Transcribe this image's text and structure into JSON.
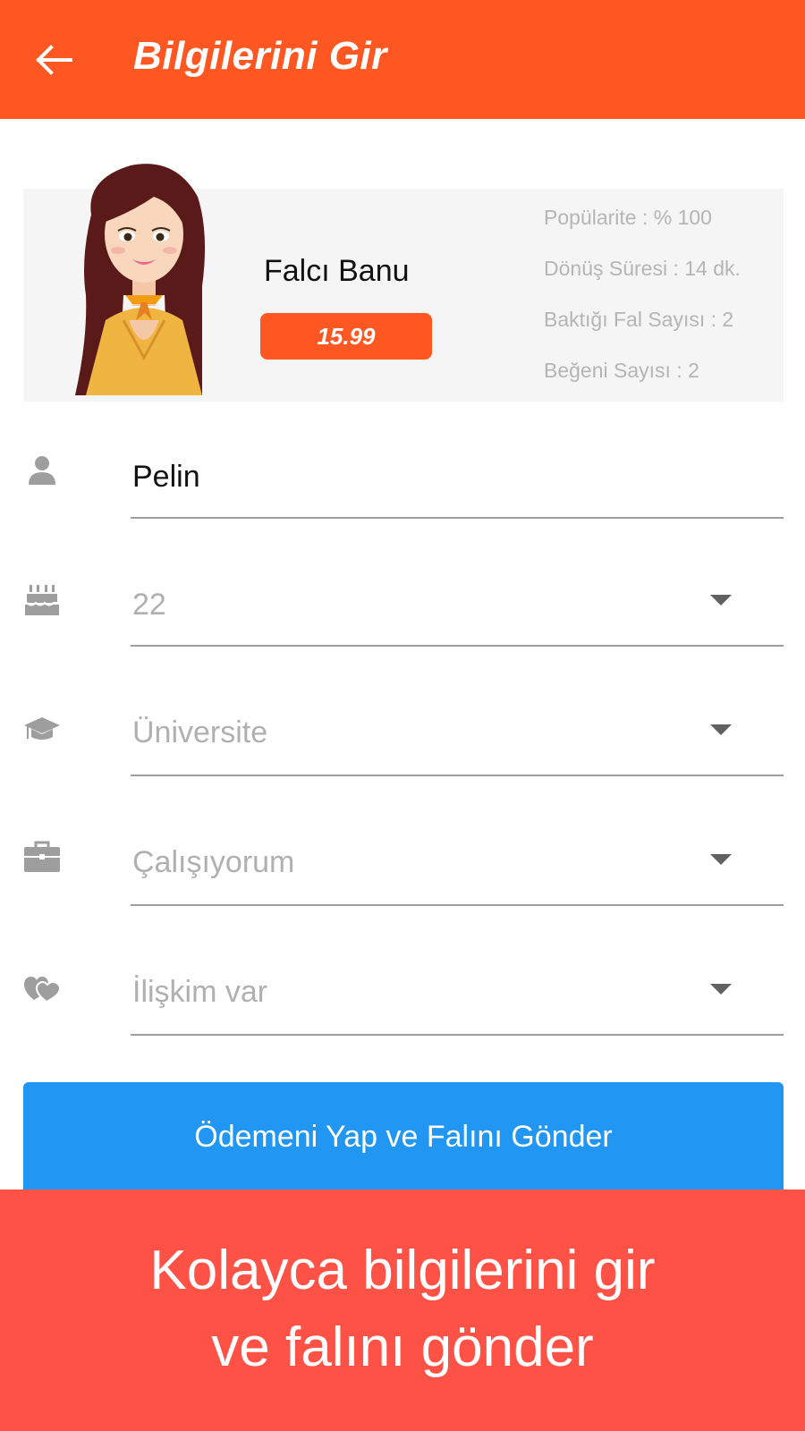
{
  "appbar": {
    "back_icon": "arrow-left-icon",
    "title": "Bilgilerini Gir"
  },
  "fortune_teller": {
    "name": "Falcı Banu",
    "price": "15.99",
    "stats": [
      "Popülarite : % 100",
      "Dönüş Süresi : 14 dk.",
      "Baktığı Fal Sayısı : 2",
      "Beğeni Sayısı : 2"
    ]
  },
  "form": {
    "name": {
      "icon": "person-icon",
      "value": "Pelin"
    },
    "age": {
      "icon": "birthday-cake-icon",
      "value": "22"
    },
    "education": {
      "icon": "graduation-cap-icon",
      "value": "Üniversite"
    },
    "employment": {
      "icon": "briefcase-icon",
      "value": "Çalışıyorum"
    },
    "relationship": {
      "icon": "hearts-icon",
      "value": "İlişkim var"
    }
  },
  "submit_button": {
    "label": "Ödemeni Yap ve Falını Gönder"
  },
  "promo": {
    "line1": "Kolayca bilgilerini gir",
    "line2": "ve falını gönder"
  },
  "colors": {
    "appbar": "#fe5722",
    "price_badge": "#fe5722",
    "submit_button": "#2196f3",
    "promo_banner": "#fe5246"
  }
}
